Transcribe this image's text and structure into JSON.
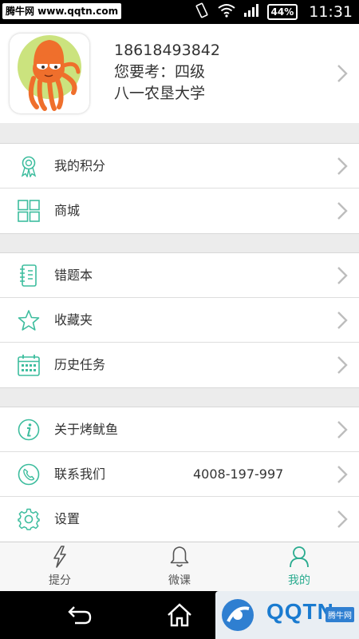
{
  "status_bar": {
    "watermark": "腾牛网 www.qqtn.com",
    "battery": "44%",
    "time": "11:31"
  },
  "profile": {
    "phone": "18618493842",
    "exam_line": "您要考：四级",
    "school": "八一农垦大学"
  },
  "menu_groups": [
    {
      "items": [
        {
          "icon": "award-ribbon-icon",
          "label": "我的积分"
        },
        {
          "icon": "grid-icon",
          "label": "商城"
        }
      ]
    },
    {
      "items": [
        {
          "icon": "notebook-icon",
          "label": "错题本"
        },
        {
          "icon": "star-icon",
          "label": "收藏夹"
        },
        {
          "icon": "calendar-icon",
          "label": "历史任务"
        }
      ]
    },
    {
      "items": [
        {
          "icon": "info-icon",
          "label": "关于烤鱿鱼"
        },
        {
          "icon": "phone-icon",
          "label": "联系我们",
          "value": "4008-197-997"
        },
        {
          "icon": "gear-icon",
          "label": "设置"
        }
      ]
    }
  ],
  "bottom_nav": {
    "items": [
      {
        "icon": "lightning-icon",
        "label": "提分"
      },
      {
        "icon": "bell-icon",
        "label": "微课"
      },
      {
        "icon": "person-icon",
        "label": "我的",
        "active": true
      }
    ]
  },
  "system_watermark": {
    "text": "QQTN",
    "tag": "腾牛网"
  },
  "colors": {
    "accent": "#2aab8f",
    "icon": "#3dbd9e",
    "background": "#ececec",
    "chevron": "#bdbdbd"
  }
}
